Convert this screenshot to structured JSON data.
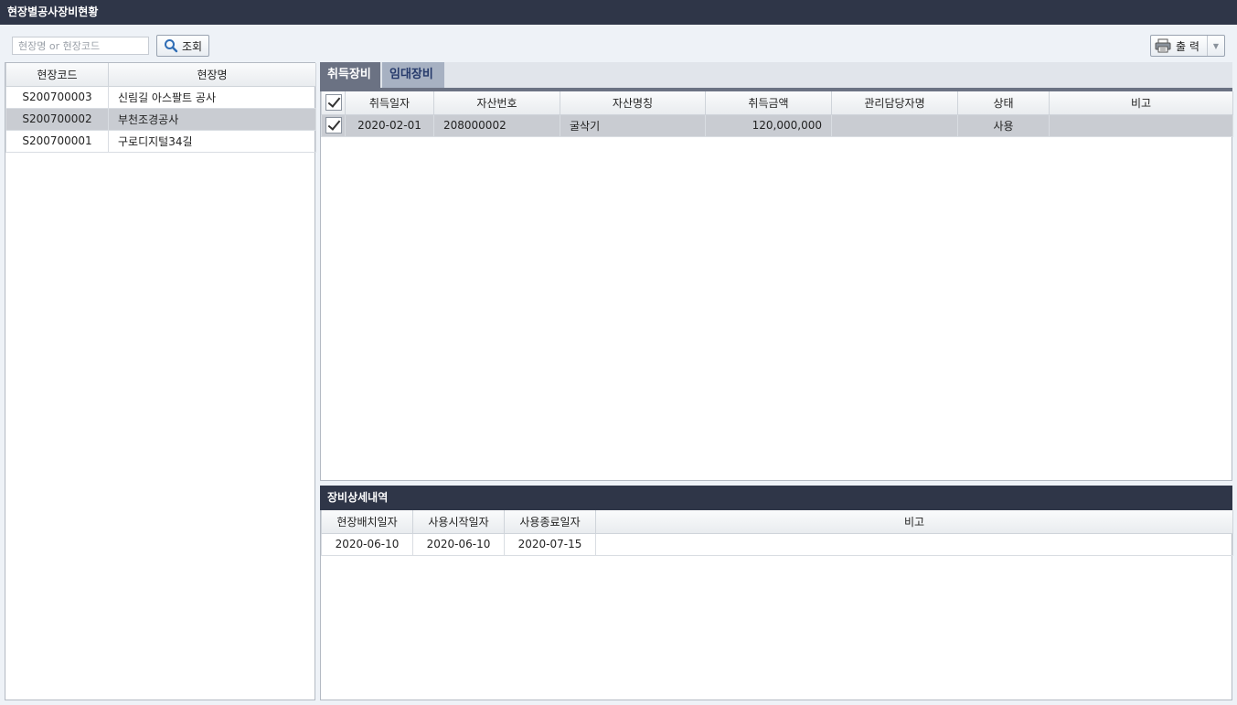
{
  "window": {
    "title": "현장별공사장비현황"
  },
  "search": {
    "placeholder": "현장명 or 현장코드",
    "value": "",
    "button_label": "조회"
  },
  "toolbar": {
    "print_label": "출 력"
  },
  "site_grid": {
    "columns": [
      "현장코드",
      "현장명"
    ],
    "rows": [
      {
        "code": "S200700003",
        "name": "신림길 아스팔트 공사"
      },
      {
        "code": "S200700002",
        "name": "부천조경공사"
      },
      {
        "code": "S200700001",
        "name": "구로디지털34길"
      }
    ],
    "selected_row": 1
  },
  "tabs": [
    {
      "label": "취득장비",
      "active": true
    },
    {
      "label": "임대장비",
      "active": false
    }
  ],
  "equipment_grid": {
    "columns": [
      "취득일자",
      "자산번호",
      "자산명칭",
      "취득금액",
      "관리담당자명",
      "상태",
      "비고"
    ],
    "rows": [
      {
        "checked": true,
        "acquired_date": "2020-02-01",
        "asset_no": "208000002",
        "asset_name": "굴삭기",
        "amount": "120,000,000",
        "manager": "",
        "status": "사용",
        "note": ""
      }
    ]
  },
  "detail": {
    "title": "장비상세내역",
    "columns": [
      "현장배치일자",
      "사용시작일자",
      "사용종료일자",
      "비고"
    ],
    "rows": [
      {
        "placed_date": "2020-06-10",
        "start_date": "2020-06-10",
        "end_date": "2020-07-15",
        "note": ""
      }
    ]
  },
  "colors": {
    "titlebar": "#2f3648",
    "selected_row": "#c9ccd2",
    "tab_active": "#6b7283",
    "tab_inactive": "#a7b1c2"
  }
}
